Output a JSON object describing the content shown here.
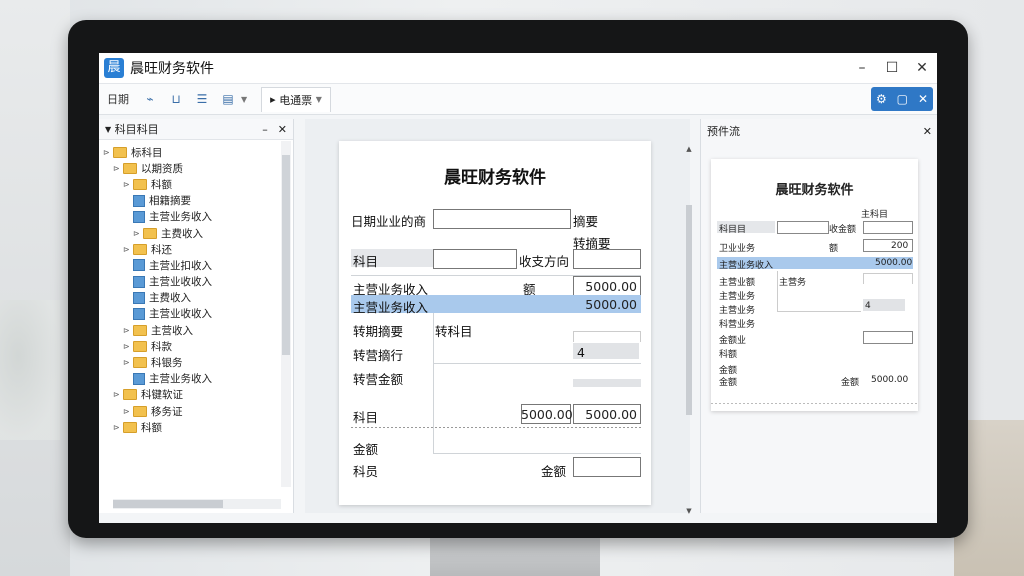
{
  "app": {
    "title": "晨旺财务软件",
    "icon": "晨"
  },
  "window_controls": {
    "minimize": "–",
    "maximize": "☐",
    "close": "✕"
  },
  "toolbar": {
    "first_item": "日期",
    "tab_label": "电通票",
    "tab_arrow": "▸",
    "right_icons": [
      "⚙",
      "▢",
      "✕"
    ]
  },
  "left_panel": {
    "title": "科目科目",
    "nodes": [
      {
        "label": "标科目",
        "type": "folder"
      },
      {
        "label": "以期资质",
        "type": "folder"
      },
      {
        "label": "科额",
        "type": "folder"
      },
      {
        "label": "相籍摘要",
        "type": "doc"
      },
      {
        "label": "主营业务收入",
        "type": "doc"
      },
      {
        "label": "主费收入",
        "type": "folder"
      },
      {
        "label": "科还",
        "type": "folder"
      },
      {
        "label": "主营业扣收入",
        "type": "doc"
      },
      {
        "label": "主营业收收入",
        "type": "doc"
      },
      {
        "label": "主费收入",
        "type": "doc"
      },
      {
        "label": "主营业收收入",
        "type": "doc"
      },
      {
        "label": "主营收入",
        "type": "folder"
      },
      {
        "label": "科款",
        "type": "folder"
      },
      {
        "label": "科银务",
        "type": "folder"
      },
      {
        "label": "主营业务收入",
        "type": "doc"
      },
      {
        "label": "科键软证",
        "type": "folder"
      },
      {
        "label": "移务证",
        "type": "folder"
      },
      {
        "label": "科额",
        "type": "folder"
      }
    ]
  },
  "voucher": {
    "title": "晨旺财务软件",
    "date_label": "日期业业的商",
    "summary_label": "摘要",
    "summary_label2": "转摘要",
    "subject_label": "科目",
    "direction_label": "收支方向",
    "row1_label": "主营业务收入",
    "row1_mid": "额",
    "row1_value": "5000.00",
    "row2_label": "主营业务收入",
    "row2_value": "5000.00",
    "row3_label": "转期摘要",
    "row3_mid": "转科目",
    "row4_label": "转营摘行",
    "row4_value": "4",
    "row5_label": "转营金额",
    "row6_label": "科目",
    "row6_mid_value": "5000.00",
    "row6_value": "5000.00",
    "amount_label": "金额",
    "subject2_label": "科员",
    "amount_label2": "金额"
  },
  "right_panel": {
    "title": "预件流",
    "preview": {
      "title": "晨旺财务软件",
      "header": "主科目",
      "subject_label": "科目目",
      "amount_label": "收金额",
      "l_row1": "卫业业务",
      "l_row1_mid": "额",
      "l_row1_val": "200",
      "hl_label": "主营业务收入",
      "hl_value": "5000.00",
      "l_row3": "主营业额",
      "l_row3_mid": "主营务",
      "l_row4": "主营业务",
      "l_row5": "主营业务",
      "l_row5_val": "4",
      "l_row6": "科营业务",
      "l_row7": "金额业",
      "l_row8": "科额",
      "l_row9": "金额",
      "l_row10": "金额",
      "total_label": "金额",
      "total_value": "5000.00"
    }
  }
}
